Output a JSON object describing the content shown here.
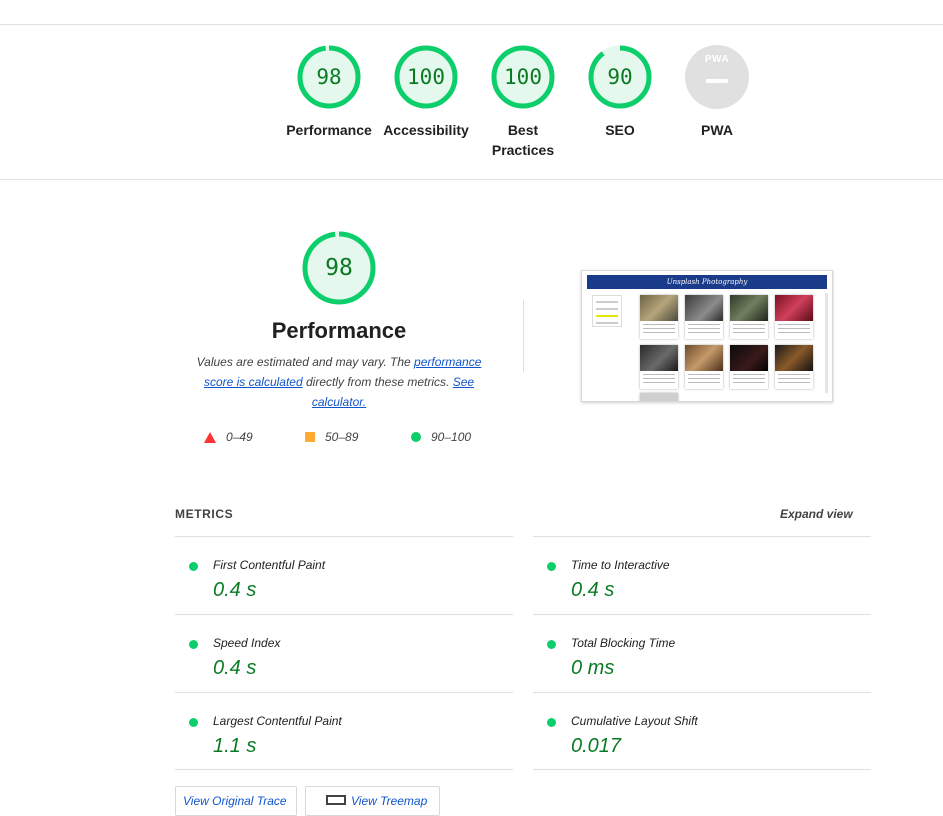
{
  "colors": {
    "pass": "#0cce6b",
    "pass_text": "#0a7a23",
    "pass_bg": "#e5f8ed",
    "average": "#ffaa33",
    "fail": "#ff3333",
    "na": "#e0e0e0"
  },
  "summary": {
    "gauges": [
      {
        "label": "Performance",
        "score": 98
      },
      {
        "label": "Accessibility",
        "score": 100
      },
      {
        "label": "Best Practices",
        "score": 100
      },
      {
        "label": "SEO",
        "score": 90
      },
      {
        "label": "PWA",
        "score_text": "PWA",
        "icon": "pwa-dash-icon"
      }
    ]
  },
  "performance": {
    "score": 98,
    "title": "Performance",
    "desc_before": "Values are estimated and may vary. The ",
    "desc_link1": "performance score is calculated",
    "desc_middle": " directly from these metrics. ",
    "desc_link2": "See calculator.",
    "legend": [
      {
        "icon": "triangle-fail-icon",
        "range": "0–49"
      },
      {
        "icon": "square-average-icon",
        "range": "50–89"
      },
      {
        "icon": "circle-pass-icon",
        "range": "90–100"
      }
    ]
  },
  "screenshot": {
    "site_title": "Unsplash Photography"
  },
  "metrics": {
    "heading": "METRICS",
    "expand": "Expand view",
    "items": [
      {
        "label": "First Contentful Paint",
        "value": "0.4 s"
      },
      {
        "label": "Time to Interactive",
        "value": "0.4 s"
      },
      {
        "label": "Speed Index",
        "value": "0.4 s"
      },
      {
        "label": "Total Blocking Time",
        "value": "0 ms"
      },
      {
        "label": "Largest Contentful Paint",
        "value": "1.1 s"
      },
      {
        "label": "Cumulative Layout Shift",
        "value": "0.017"
      }
    ]
  },
  "buttons": {
    "trace": "View Original Trace",
    "treemap": "View Treemap"
  }
}
